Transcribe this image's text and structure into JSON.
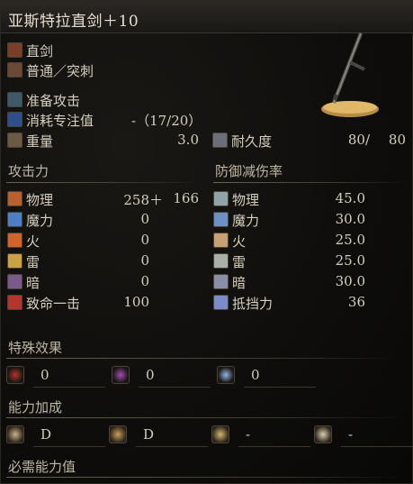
{
  "weapon_name": "亚斯特拉直剑＋10",
  "weapon_type": "直剑",
  "attack_type": "普通／突刺",
  "skill": "准备攻击",
  "fp_cost_label": "消耗专注值",
  "fp_cost_value": "-（17/20）",
  "weight_label": "重量",
  "weight_value": "3.0",
  "durability_label": "耐久度",
  "durability_value": "80/",
  "durability_max": "80",
  "attack": {
    "header": "攻击力",
    "rows": [
      {
        "label": "物理",
        "value": "258＋",
        "bonus": "166",
        "icon": "physical-icon",
        "color": "#b8612e"
      },
      {
        "label": "魔力",
        "value": "0",
        "icon": "magic-icon",
        "color": "#4d7fc7"
      },
      {
        "label": "火",
        "value": "0",
        "icon": "fire-icon",
        "color": "#d2632a"
      },
      {
        "label": "雷",
        "value": "0",
        "icon": "lightning-icon",
        "color": "#c9a243"
      },
      {
        "label": "暗",
        "value": "0",
        "icon": "dark-icon",
        "color": "#7a5a8a"
      },
      {
        "label": "致命一击",
        "value": "100",
        "icon": "critical-icon",
        "color": "#b3352c"
      }
    ]
  },
  "defense": {
    "header": "防御减伤率",
    "rows": [
      {
        "label": "物理",
        "value": "45.0",
        "icon": "physical-defense-icon",
        "color": "#8fa4a8"
      },
      {
        "label": "魔力",
        "value": "30.0",
        "icon": "magic-defense-icon",
        "color": "#6b8fc6"
      },
      {
        "label": "火",
        "value": "25.0",
        "icon": "fire-defense-icon",
        "color": "#c9a071"
      },
      {
        "label": "雷",
        "value": "25.0",
        "icon": "lightning-defense-icon",
        "color": "#a8b0a8"
      },
      {
        "label": "暗",
        "value": "30.0",
        "icon": "dark-defense-icon",
        "color": "#8a8fa8"
      },
      {
        "label": "抵挡力",
        "value": "36",
        "icon": "stability-icon",
        "color": "#7a8cc9"
      }
    ]
  },
  "special_effects": {
    "header": "特殊效果",
    "items": [
      {
        "value": "0",
        "icon": "bleed-icon",
        "color": "#b3352c"
      },
      {
        "value": "0",
        "icon": "poison-icon",
        "color": "#a24fb5"
      },
      {
        "value": "0",
        "icon": "frost-icon",
        "color": "#8fb8e6"
      }
    ]
  },
  "scaling": {
    "header": "能力加成",
    "items": [
      {
        "value": "D",
        "icon": "strength-scaling-icon",
        "color": "#c9b58a"
      },
      {
        "value": "D",
        "icon": "dexterity-scaling-icon",
        "color": "#c9a05a"
      },
      {
        "value": "-",
        "icon": "intelligence-scaling-icon",
        "color": "#d4b870"
      },
      {
        "value": "-",
        "icon": "faith-scaling-icon",
        "color": "#d8d0b0"
      }
    ]
  },
  "requirements": {
    "header": "必需能力值"
  }
}
